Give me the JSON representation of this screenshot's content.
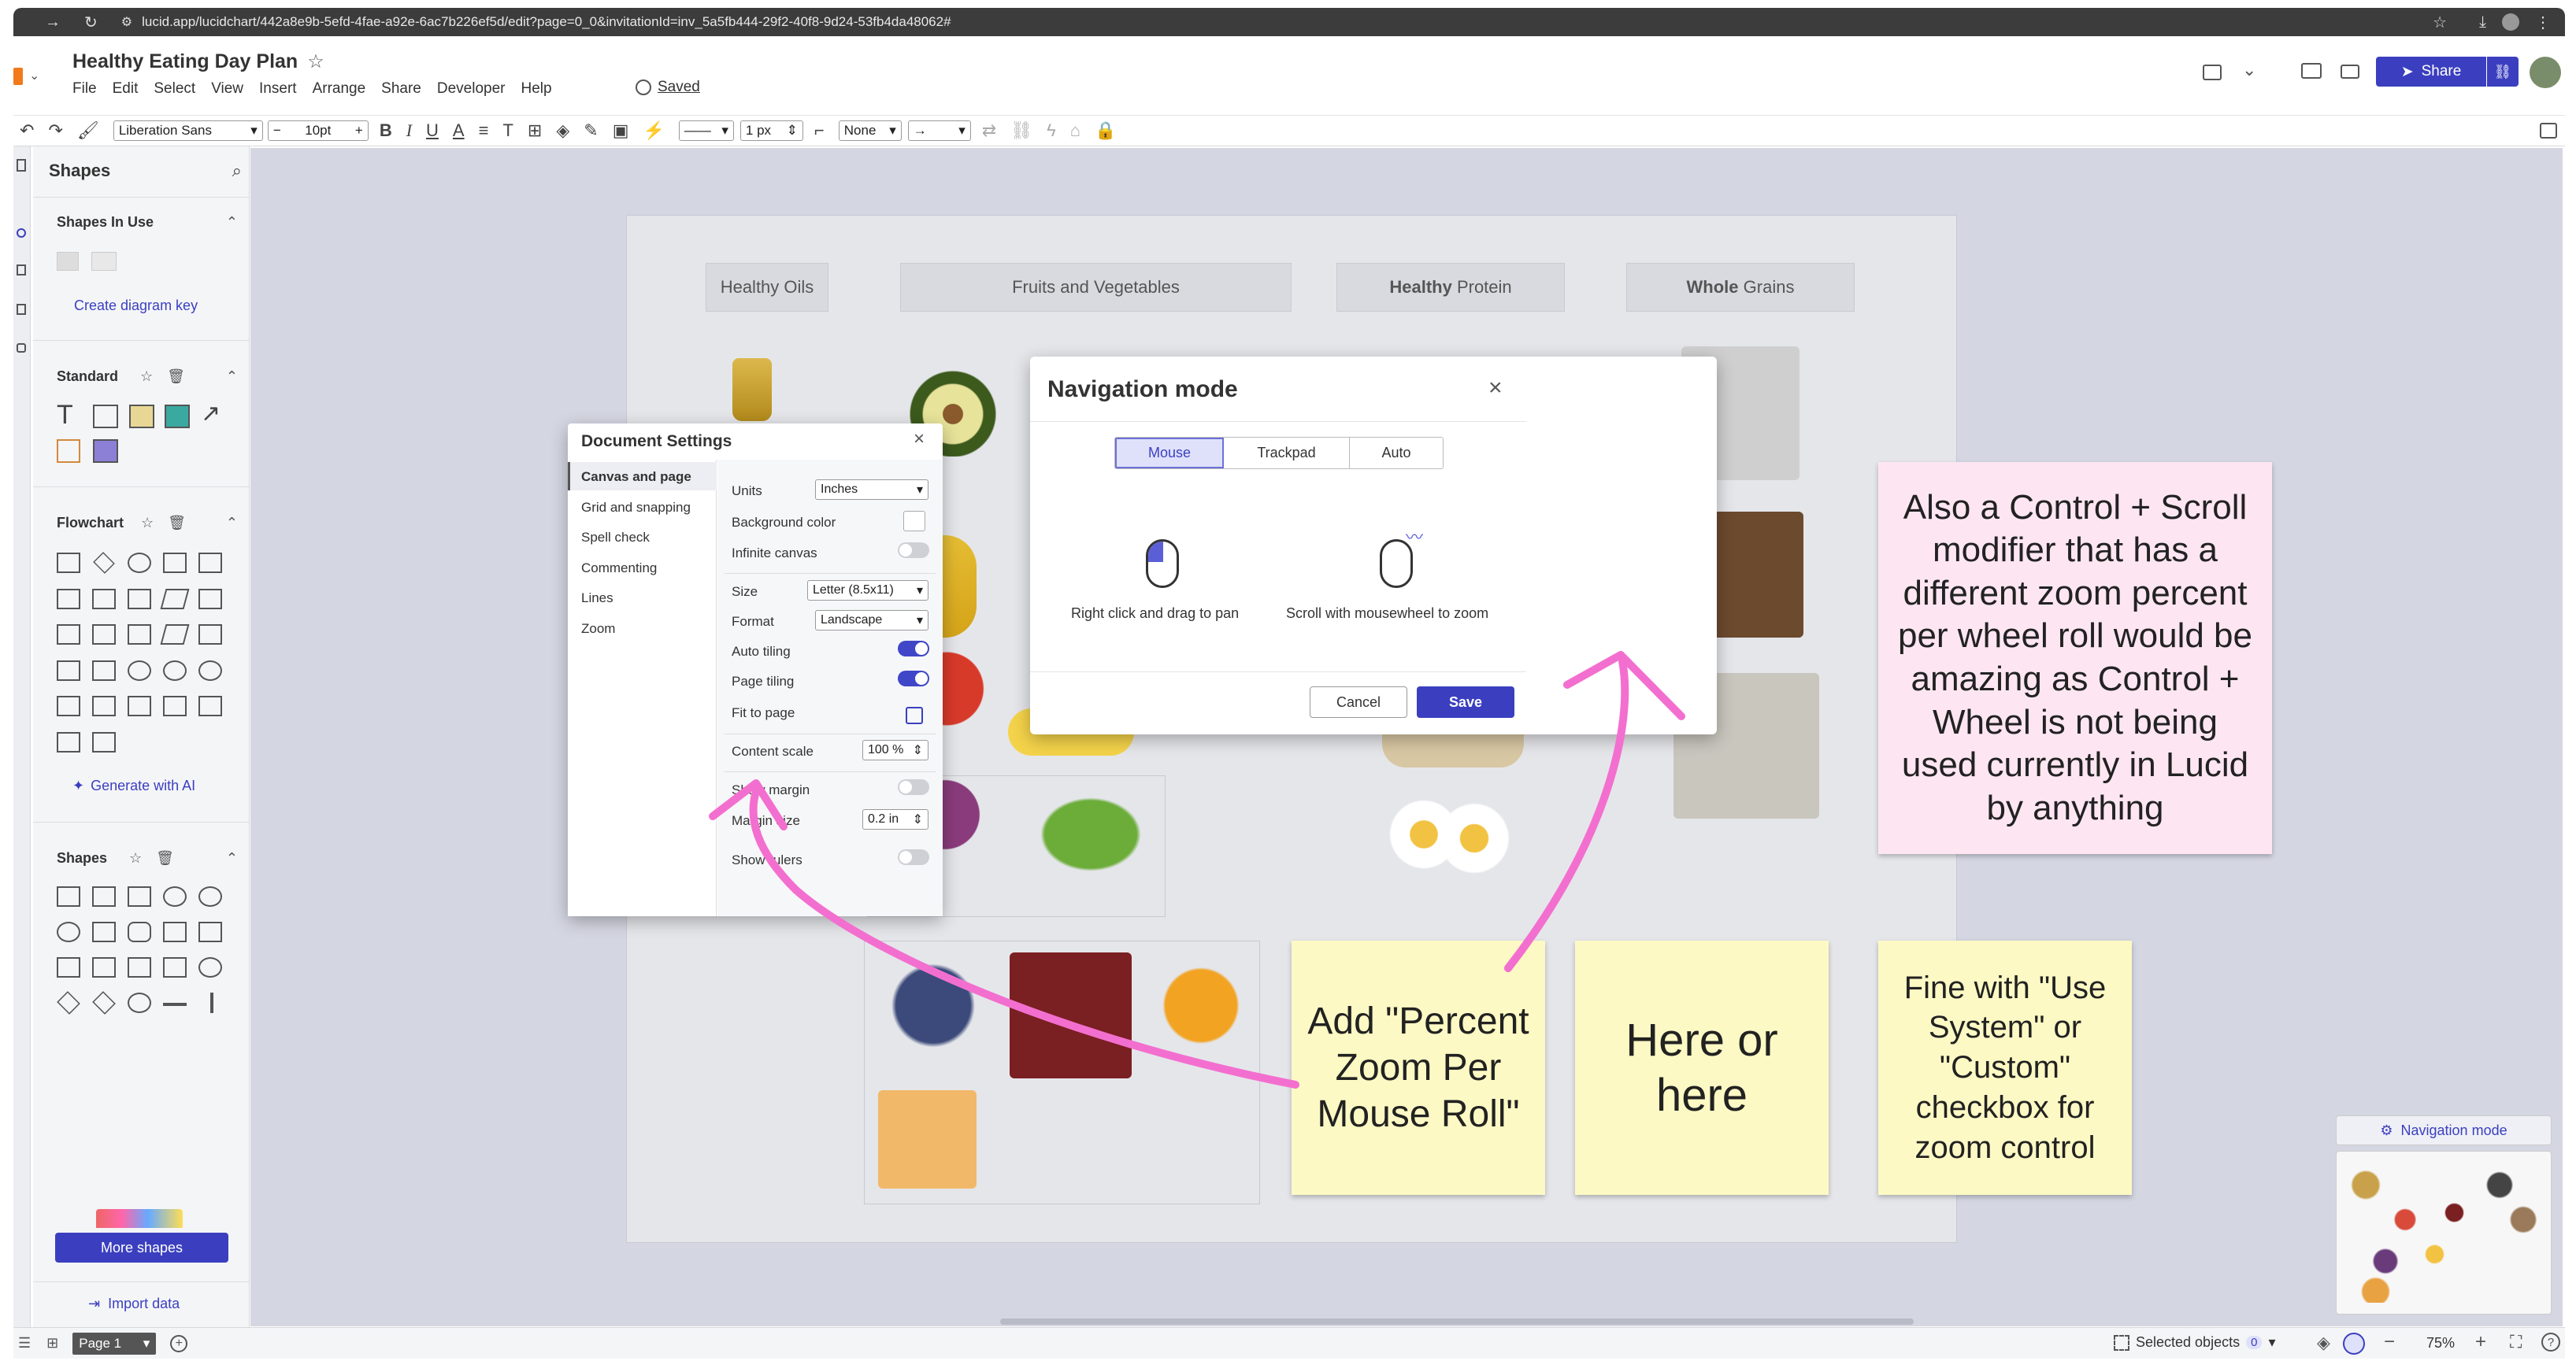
{
  "browser": {
    "url": "lucid.app/lucidchart/442a8e9b-5efd-4fae-a92e-6ac7b226ef5d/edit?page=0_0&invitationId=inv_5a5fb444-29f2-40f8-9d24-53fb4da48062#"
  },
  "header": {
    "doc_title": "Healthy Eating Day Plan",
    "menu": [
      "File",
      "Edit",
      "Select",
      "View",
      "Insert",
      "Arrange",
      "Share",
      "Developer",
      "Help"
    ],
    "saved_label": "Saved",
    "share_label": "Share"
  },
  "toolbar": {
    "font": "Liberation Sans",
    "font_size": "10pt",
    "line_width": "1 px",
    "line_start": "None"
  },
  "shapes_panel": {
    "title": "Shapes",
    "in_use_title": "Shapes In Use",
    "create_key": "Create diagram key",
    "standard_title": "Standard",
    "flowchart_title": "Flowchart",
    "generate_ai": "Generate with AI",
    "shapes_title": "Shapes",
    "more_shapes": "More shapes",
    "import_data": "Import data"
  },
  "canvas": {
    "categories": [
      {
        "bold": "",
        "rest": "Healthy Oils"
      },
      {
        "bold": "",
        "rest": "Fruits and Vegetables"
      },
      {
        "bold": "Healthy",
        "rest": " Protein"
      },
      {
        "bold": "Whole",
        "rest": " Grains"
      }
    ],
    "stickies": {
      "note1": "Add \"Percent Zoom Per Mouse Roll\"",
      "note2": "Here or here",
      "note3": "Fine with \"Use System\" or \"Custom\" checkbox for zoom control",
      "note4": "Also a Control + Scroll modifier that has a different zoom percent per wheel roll would be amazing as Control + Wheel is not being used currently in Lucid by anything"
    }
  },
  "doc_settings": {
    "title": "Document Settings",
    "nav": [
      "Canvas and page",
      "Grid and snapping",
      "Spell check",
      "Commenting",
      "Lines",
      "Zoom"
    ],
    "units_label": "Units",
    "units_value": "Inches",
    "bg_label": "Background color",
    "infinite_label": "Infinite canvas",
    "size_label": "Size",
    "size_value": "Letter (8.5x11)",
    "format_label": "Format",
    "format_value": "Landscape",
    "auto_tiling_label": "Auto tiling",
    "page_tiling_label": "Page tiling",
    "fit_label": "Fit to page",
    "scale_label": "Content scale",
    "scale_value": "100 %",
    "show_margin_label": "Show margin",
    "margin_size_label": "Margin size",
    "margin_size_value": "0.2 in",
    "show_rulers_label": "Show rulers"
  },
  "nav_mode": {
    "title": "Navigation mode",
    "tabs": [
      "Mouse",
      "Trackpad",
      "Auto"
    ],
    "pan_caption": "Right click and drag to pan",
    "zoom_caption": "Scroll with mousewheel to zoom",
    "cancel": "Cancel",
    "save": "Save"
  },
  "minimap": {
    "nav_button": "Navigation mode"
  },
  "status": {
    "page_label": "Page 1",
    "selected_label": "Selected objects",
    "selected_count": "0",
    "zoom": "75%"
  },
  "colors": {
    "accent": "#3b3fbf",
    "sticky_yellow": "#fdf9c4",
    "sticky_pink": "#fde6f1",
    "arrow_pink": "#f36fcf",
    "canvas_bg": "#d4d6e2"
  }
}
